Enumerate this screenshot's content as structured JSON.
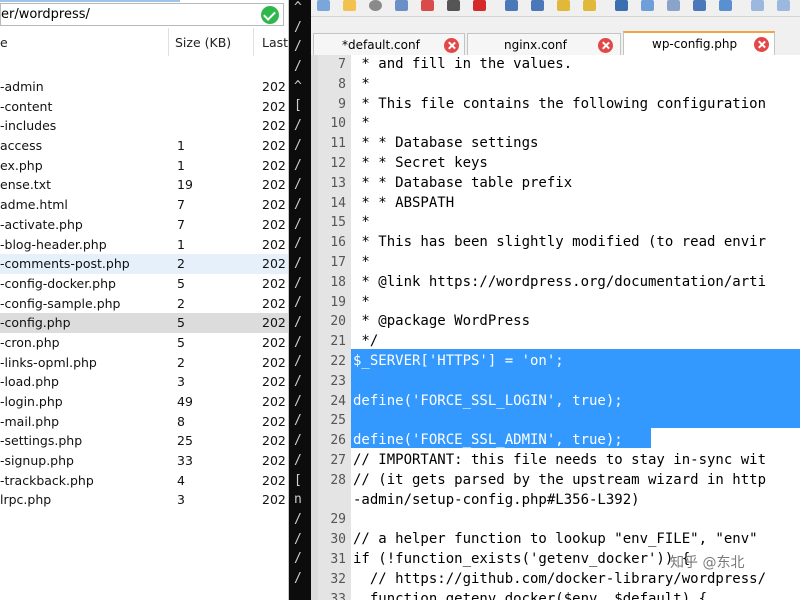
{
  "left_panel": {
    "path": "er/wordpress/",
    "columns": {
      "name": "e",
      "size": "Size (KB)",
      "last": "Last"
    },
    "files": [
      {
        "name": "-admin",
        "size": "",
        "date": "202"
      },
      {
        "name": "-content",
        "size": "",
        "date": "202"
      },
      {
        "name": "-includes",
        "size": "",
        "date": "202"
      },
      {
        "name": "access",
        "size": "1",
        "date": "202"
      },
      {
        "name": "ex.php",
        "size": "1",
        "date": "202"
      },
      {
        "name": "ense.txt",
        "size": "19",
        "date": "202"
      },
      {
        "name": "adme.html",
        "size": "7",
        "date": "202"
      },
      {
        "name": "-activate.php",
        "size": "7",
        "date": "202"
      },
      {
        "name": "-blog-header.php",
        "size": "1",
        "date": "202"
      },
      {
        "name": "-comments-post.php",
        "size": "2",
        "date": "202"
      },
      {
        "name": "-config-docker.php",
        "size": "5",
        "date": "202"
      },
      {
        "name": "-config-sample.php",
        "size": "2",
        "date": "202"
      },
      {
        "name": "-config.php",
        "size": "5",
        "date": "202"
      },
      {
        "name": "-cron.php",
        "size": "5",
        "date": "202"
      },
      {
        "name": "-links-opml.php",
        "size": "2",
        "date": "202"
      },
      {
        "name": "-load.php",
        "size": "3",
        "date": "202"
      },
      {
        "name": "-login.php",
        "size": "49",
        "date": "202"
      },
      {
        "name": "-mail.php",
        "size": "8",
        "date": "202"
      },
      {
        "name": "-settings.php",
        "size": "25",
        "date": "202"
      },
      {
        "name": "-signup.php",
        "size": "33",
        "date": "202"
      },
      {
        "name": "-trackback.php",
        "size": "4",
        "date": "202"
      },
      {
        "name": "lrpc.php",
        "size": "3",
        "date": "202"
      }
    ]
  },
  "console_lines": [
    "^",
    "/",
    "/",
    "/",
    "^",
    "[",
    "/",
    "/",
    "/",
    "/",
    "/",
    "/",
    "/",
    "/",
    "/",
    "/",
    "/",
    "/",
    "/",
    "/",
    "/",
    "/",
    "/",
    "/",
    "[",
    "n",
    "/",
    "/",
    "/",
    "/"
  ],
  "tabs": [
    {
      "label": "*default.conf",
      "active": false
    },
    {
      "label": "nginx.conf",
      "active": false
    },
    {
      "label": "wp-config.php",
      "active": true
    }
  ],
  "editor_lines": [
    {
      "num": "7",
      "text": " * and fill in the values."
    },
    {
      "num": "8",
      "text": " *"
    },
    {
      "num": "9",
      "text": " * This file contains the following configuration"
    },
    {
      "num": "10",
      "text": " *"
    },
    {
      "num": "11",
      "text": " * * Database settings"
    },
    {
      "num": "12",
      "text": " * * Secret keys"
    },
    {
      "num": "13",
      "text": " * * Database table prefix"
    },
    {
      "num": "14",
      "text": " * * ABSPATH"
    },
    {
      "num": "15",
      "text": " *"
    },
    {
      "num": "16",
      "text": " * This has been slightly modified (to read envir"
    },
    {
      "num": "17",
      "text": " *"
    },
    {
      "num": "18",
      "text": " * @link https://wordpress.org/documentation/arti"
    },
    {
      "num": "19",
      "text": " *"
    },
    {
      "num": "20",
      "text": " * @package WordPress"
    },
    {
      "num": "21",
      "text": " */"
    },
    {
      "num": "22",
      "text": "$_SERVER['HTTPS'] = 'on';"
    },
    {
      "num": "23",
      "text": ""
    },
    {
      "num": "24",
      "text": "define('FORCE_SSL_LOGIN', true);"
    },
    {
      "num": "25",
      "text": ""
    },
    {
      "num": "26",
      "text": "define('FORCE_SSL_ADMIN', true);"
    },
    {
      "num": "27",
      "text": "// IMPORTANT: this file needs to stay in-sync wit"
    },
    {
      "num": "28",
      "text": "// (it gets parsed by the upstream wizard in http"
    },
    {
      "num": "",
      "text": "-admin/setup-config.php#L356-L392)"
    },
    {
      "num": "29",
      "text": ""
    },
    {
      "num": "30",
      "text": "// a helper function to lookup \"env_FILE\", \"env\""
    },
    {
      "num": "31",
      "text": "if (!function_exists('getenv_docker')) {"
    },
    {
      "num": "32",
      "text": "  // https://github.com/docker-library/wordpress/"
    },
    {
      "num": "33",
      "text": "  function getenv_docker($env, $default) {"
    }
  ],
  "watermark": "知乎 @东北",
  "colors": {
    "selection": "#3399ff",
    "comment": "#008000",
    "tab_accent": "#f2a640",
    "close": "#e34848",
    "ok": "#2eb84b"
  }
}
